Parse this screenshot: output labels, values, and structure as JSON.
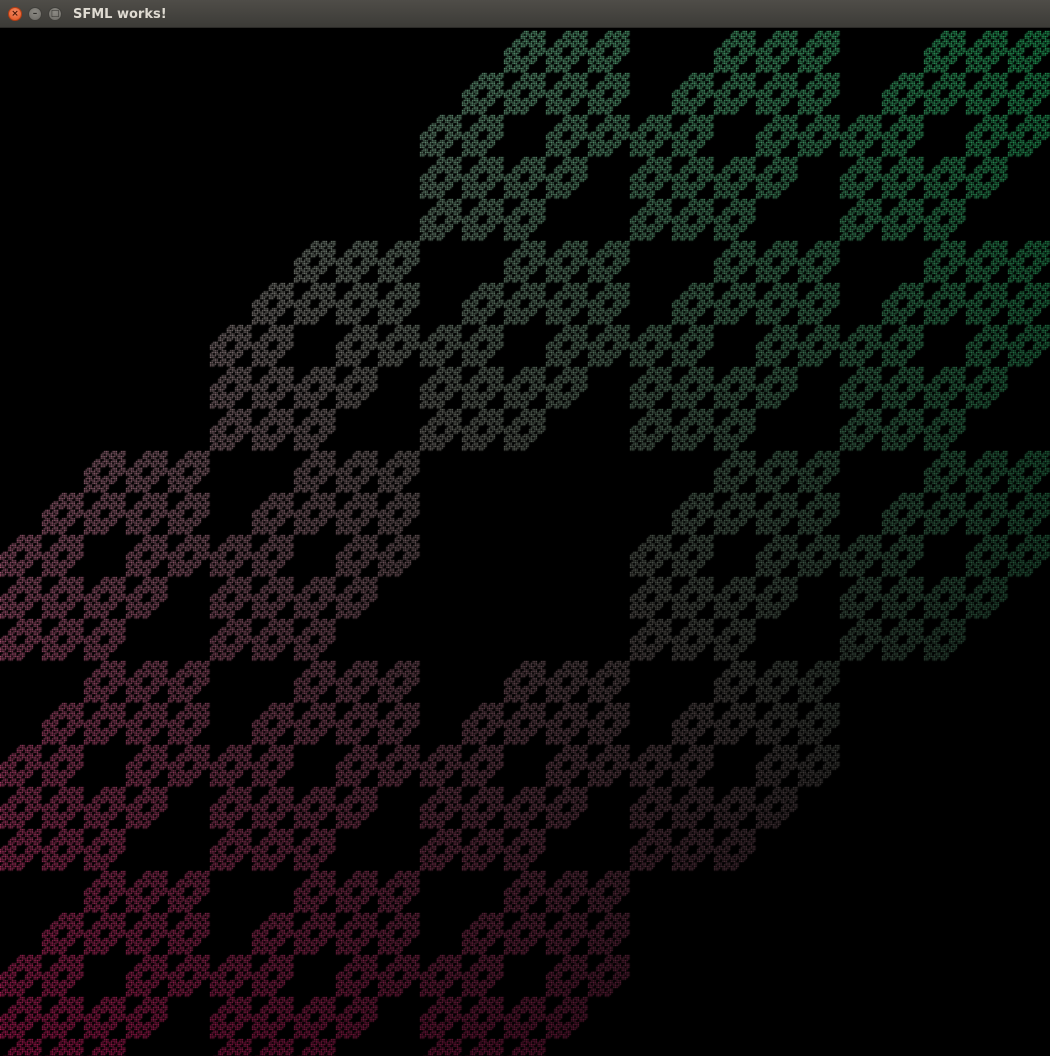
{
  "window": {
    "title": "SFML works!",
    "close_glyph": "×",
    "minimize_glyph": "–",
    "maximize_glyph": "□"
  },
  "canvas": {
    "background": "#000000",
    "colors": {
      "top_right": "#2ed678",
      "top_left": "#c9cfc9",
      "bottom_left": "#d81e68",
      "bottom_right": "#2e1a26"
    }
  }
}
